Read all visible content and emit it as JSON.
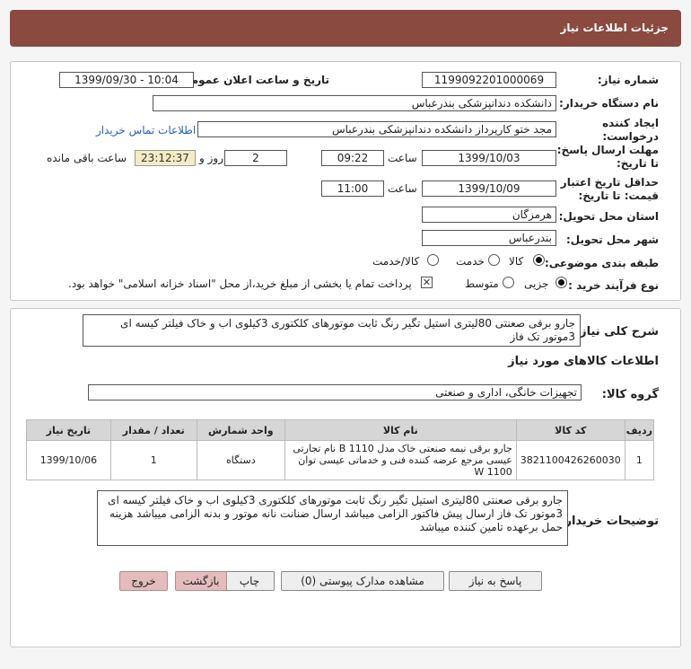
{
  "header": {
    "title": "جزئیات اطلاعات نیاز"
  },
  "form": {
    "need_number_label": "شماره نیاز:",
    "need_number": "1199092201000069",
    "announce_label": "تاریخ و ساعت اعلان عمومی:",
    "announce_value": "1399/09/30 - 10:04",
    "buyer_org_label": "نام دستگاه خریدار:",
    "buyer_org": "دانشکده دندانپزشکی بندرعباس",
    "creator_label_1": "ایجاد کننده",
    "creator_label_2": "درخواست:",
    "creator": "مجد ختو کارپرداز دانشکده دندانپزشکی بندرعباس",
    "contact_link": "اطلاعات تماس خریدار",
    "deadline_label_1": "مهلت ارسال پاسخ:",
    "deadline_label_2": "تا تاریخ:",
    "deadline_date": "1399/10/03",
    "time_label": "ساعت",
    "deadline_time": "09:22",
    "days_value": "2",
    "days_label": "روز و",
    "countdown": "23:12:37",
    "remaining_label": "ساعت باقی مانده",
    "validity_label_1": "حداقل تاریخ اعتبار",
    "validity_label_2": "قیمت: تا تاریخ:",
    "validity_date": "1399/10/09",
    "validity_time": "11:00",
    "province_label": "استان محل تحویل:",
    "province": "هرمزگان",
    "city_label": "شهر محل تحویل:",
    "city": "بندرعباس",
    "category_label": "طبقه بندی موضوعی:",
    "category_options": [
      "کالا",
      "خدمت",
      "کالا/خدمت"
    ],
    "process_label": "نوع فرآیند خرید :",
    "process_options": [
      "جزیی",
      "متوسط"
    ],
    "payment_note": "پرداخت تمام یا بخشی از مبلغ خرید،از محل \"اسناد خزانه اسلامی\" خواهد بود."
  },
  "summary": {
    "label": "شرح کلی نیاز:",
    "text": "جارو برقی صعنتی 80لیتری استیل  تگیر رنگ ثابت موتورهای کلکتوری 3کیلوی اب و خاک فیلتر کیسه ای 3موتور تک فاز"
  },
  "goods": {
    "section_title": "اطلاعات کالاهای مورد نیاز",
    "group_label": "گروه کالا:",
    "group_value": "تجهیزات خانگی، اداری و صنعتی",
    "columns": [
      "ردیف",
      "کد کالا",
      "نام کالا",
      "واحد شمارش",
      "تعداد / مقدار",
      "تاریخ نیاز"
    ],
    "rows": [
      {
        "index": "1",
        "code": "3821100426260030",
        "name": "جارو برقی نیمه صنعتی خاک مدل B 1110 نام تجارتی عیسی مرجع عرضه کننده فنی و خدماتی عیسی توان W 1100",
        "unit": "دستگاه",
        "qty": "1",
        "date": "1399/10/06"
      }
    ]
  },
  "buyer_notes": {
    "label": "توضیحات خریدار:",
    "text": "جارو برقی صعنتی 80لیتری استیل  تگیر رنگ ثابت موتورهای کلکتوری 3کیلوی اب و خاک فیلتر کیسه ای 3موتور تک فاز ارسال پیش فاکتور الزامی میباشد ارسال ضنانت نانه موتور و بدنه الزامی میباشد هزینه حمل برعهده تامین کننده میباشد"
  },
  "buttons": {
    "reply": "پاسخ به نیاز",
    "attachments": "مشاهده مدارک پیوستی (0)",
    "print": "چاپ",
    "back": "بازگشت",
    "exit": "خروج"
  }
}
